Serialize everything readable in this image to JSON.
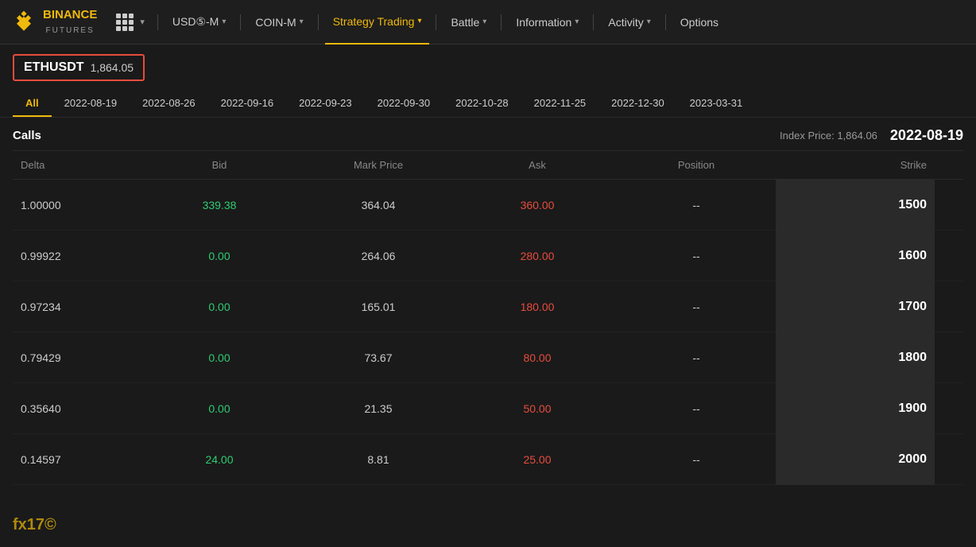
{
  "logo": {
    "brand": "BINANCE",
    "sub": "FUTURES"
  },
  "nav": {
    "items": [
      {
        "label": "USD⑤-M",
        "hasDropdown": true,
        "active": false
      },
      {
        "label": "COIN-M",
        "hasDropdown": true,
        "active": false
      },
      {
        "label": "Strategy Trading",
        "hasDropdown": true,
        "active": true
      },
      {
        "label": "Battle",
        "hasDropdown": true,
        "active": false
      },
      {
        "label": "Information",
        "hasDropdown": true,
        "active": false
      },
      {
        "label": "Activity",
        "hasDropdown": true,
        "active": false
      },
      {
        "label": "Options",
        "hasDropdown": false,
        "active": false
      }
    ]
  },
  "symbol": {
    "name": "ETHUSDT",
    "price": "1,864.05"
  },
  "dateTabs": [
    {
      "label": "All",
      "active": true
    },
    {
      "label": "2022-08-19",
      "active": false
    },
    {
      "label": "2022-08-26",
      "active": false
    },
    {
      "label": "2022-09-16",
      "active": false
    },
    {
      "label": "2022-09-23",
      "active": false
    },
    {
      "label": "2022-09-30",
      "active": false
    },
    {
      "label": "2022-10-28",
      "active": false
    },
    {
      "label": "2022-11-25",
      "active": false
    },
    {
      "label": "2022-12-30",
      "active": false
    },
    {
      "label": "2023-03-31",
      "active": false
    }
  ],
  "calls": {
    "label": "Calls",
    "indexPriceLabel": "Index Price:",
    "indexPriceValue": "1,864.06",
    "selectedDate": "2022-08-19"
  },
  "columns": {
    "delta": "Delta",
    "bid": "Bid",
    "markPrice": "Mark Price",
    "ask": "Ask",
    "position": "Position",
    "strike": "Strike"
  },
  "rows": [
    {
      "delta": "1.00000",
      "bid": "339.38",
      "bidColor": "green",
      "markPrice": "364.04",
      "ask": "360.00",
      "askColor": "red",
      "position": "--",
      "strike": "1500"
    },
    {
      "delta": "0.99922",
      "bid": "0.00",
      "bidColor": "green",
      "markPrice": "264.06",
      "ask": "280.00",
      "askColor": "red",
      "position": "--",
      "strike": "1600"
    },
    {
      "delta": "0.97234",
      "bid": "0.00",
      "bidColor": "green",
      "markPrice": "165.01",
      "ask": "180.00",
      "askColor": "red",
      "position": "--",
      "strike": "1700"
    },
    {
      "delta": "0.79429",
      "bid": "0.00",
      "bidColor": "green",
      "markPrice": "73.67",
      "ask": "80.00",
      "askColor": "red",
      "position": "--",
      "strike": "1800"
    },
    {
      "delta": "0.35640",
      "bid": "0.00",
      "bidColor": "green",
      "markPrice": "21.35",
      "ask": "50.00",
      "askColor": "red",
      "position": "--",
      "strike": "1900"
    },
    {
      "delta": "0.14597",
      "bid": "24.00",
      "bidColor": "green",
      "markPrice": "8.81",
      "ask": "25.00",
      "askColor": "red",
      "position": "--",
      "strike": "2000"
    }
  ],
  "watermark": "fx17©"
}
